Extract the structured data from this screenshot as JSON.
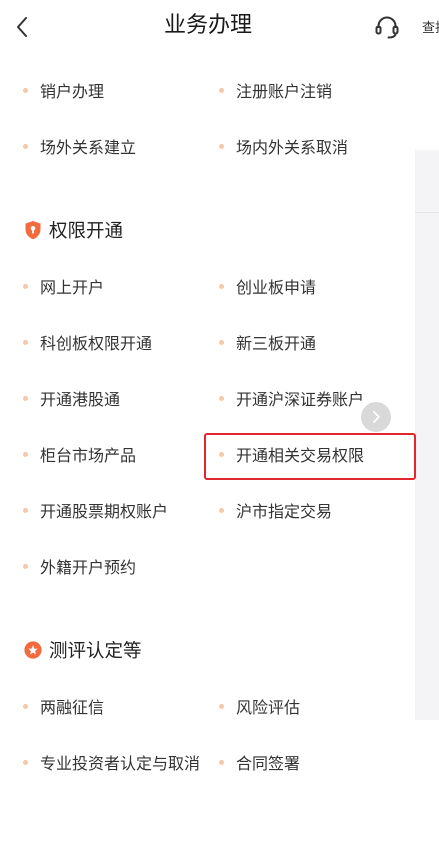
{
  "header": {
    "back_icon": "chevron-left-icon",
    "title": "业务办理",
    "support_icon": "headset-icon",
    "search_label": "查找"
  },
  "colors": {
    "accent": "#f26a3d",
    "highlight": "#e3262b",
    "bullet": "#f7c7a6",
    "text": "#333333"
  },
  "groups": [
    {
      "items": [
        {
          "label": "销户办理"
        },
        {
          "label": "注册账户注销"
        },
        {
          "label": "场外关系建立"
        },
        {
          "label": "场内外关系取消"
        }
      ]
    },
    {
      "title": "权限开通",
      "icon": "shield-icon",
      "items": [
        {
          "label": "网上开户"
        },
        {
          "label": "创业板申请"
        },
        {
          "label": "科创板权限开通"
        },
        {
          "label": "新三板开通"
        },
        {
          "label": "开通港股通"
        },
        {
          "label": "开通沪深证券账户"
        },
        {
          "label": "柜台市场产品"
        },
        {
          "label": "开通相关交易权限",
          "highlighted": true
        },
        {
          "label": "开通股票期权账户"
        },
        {
          "label": "沪市指定交易"
        },
        {
          "label": "外籍开户预约"
        }
      ]
    },
    {
      "title": "测评认定等",
      "icon": "badge-icon",
      "items": [
        {
          "label": "两融征信"
        },
        {
          "label": "风险评估"
        },
        {
          "label": "专业投资者认定与取消"
        },
        {
          "label": "合同签署"
        }
      ]
    }
  ],
  "floating_button": {
    "icon": "chevron-right-icon"
  }
}
